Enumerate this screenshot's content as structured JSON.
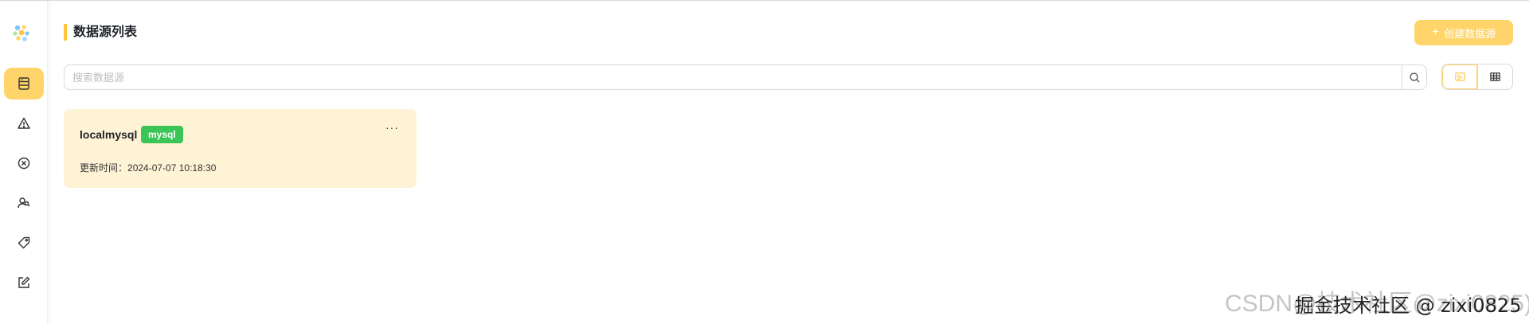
{
  "sidebar": {
    "logo": "app-logo",
    "items": [
      {
        "name": "datasource",
        "icon": "database-list-icon",
        "active": true
      },
      {
        "name": "alert",
        "icon": "warning-triangle-icon",
        "active": false
      },
      {
        "name": "error",
        "icon": "close-circle-icon",
        "active": false
      },
      {
        "name": "users",
        "icon": "user-group-icon",
        "active": false
      },
      {
        "name": "tags",
        "icon": "tag-icon",
        "active": false
      },
      {
        "name": "edit",
        "icon": "edit-icon",
        "active": false
      }
    ]
  },
  "header": {
    "title": "数据源列表",
    "create_button_label": "创建数据源",
    "create_button_icon": "+"
  },
  "search": {
    "placeholder": "搜索数据源",
    "value": ""
  },
  "view_toggle": {
    "options": [
      "card-view",
      "table-view"
    ],
    "selected": "card-view"
  },
  "cards": [
    {
      "name": "localmysql",
      "type_tag": "mysql",
      "more": "···",
      "update_label": "更新时间：",
      "update_time": "2024-07-07 10:18:30"
    }
  ],
  "watermark": {
    "text_back": "CSDN@技术社区@zixi0825)",
    "text_front": "掘金技术社区 @ zixi0825"
  },
  "colors": {
    "accent": "#ffd56b",
    "accent_bar": "#ffc53d",
    "card_bg": "#fff3d6",
    "tag_green": "#3cc557"
  }
}
